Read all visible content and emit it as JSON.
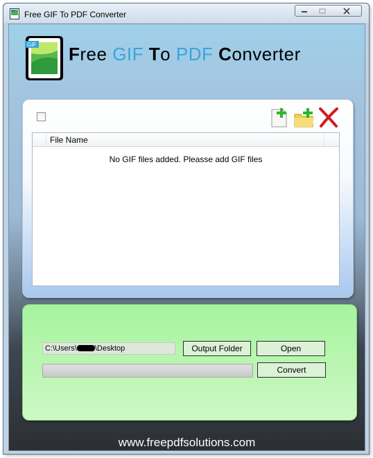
{
  "window": {
    "title": "Free GIF To PDF Converter",
    "controls": [
      "minimize",
      "maximize",
      "close"
    ]
  },
  "logo": {
    "icon_text": "GIF",
    "title_parts": [
      {
        "first": "F",
        "rest": "ree ",
        "blue": false
      },
      {
        "first": "GIF",
        "rest": " ",
        "blue": true
      },
      {
        "first": "T",
        "rest": "o ",
        "blue": false
      },
      {
        "first": "PDF",
        "rest": " ",
        "blue": true
      },
      {
        "first": "C",
        "rest": "onverter",
        "blue": false
      }
    ]
  },
  "toolbar": {
    "select_all_checked": false,
    "buttons": [
      "add-file-icon",
      "add-folder-icon",
      "remove-icon"
    ]
  },
  "file_list": {
    "columns": [
      "",
      "File Name"
    ],
    "empty_message": "No GIF files added. Pleasse add GIF files",
    "rows": []
  },
  "output": {
    "path_prefix": "C:\\Users\\",
    "path_suffix": "\\Desktop",
    "output_folder_label": "Output Folder",
    "open_label": "Open",
    "convert_label": "Convert",
    "progress": 0
  },
  "footer": {
    "url": "www.freepdfsolutions.com"
  },
  "colors": {
    "accent_blue": "#3aa3da",
    "output_panel": "#b9f6b0",
    "footer_text": "#ffffff"
  }
}
